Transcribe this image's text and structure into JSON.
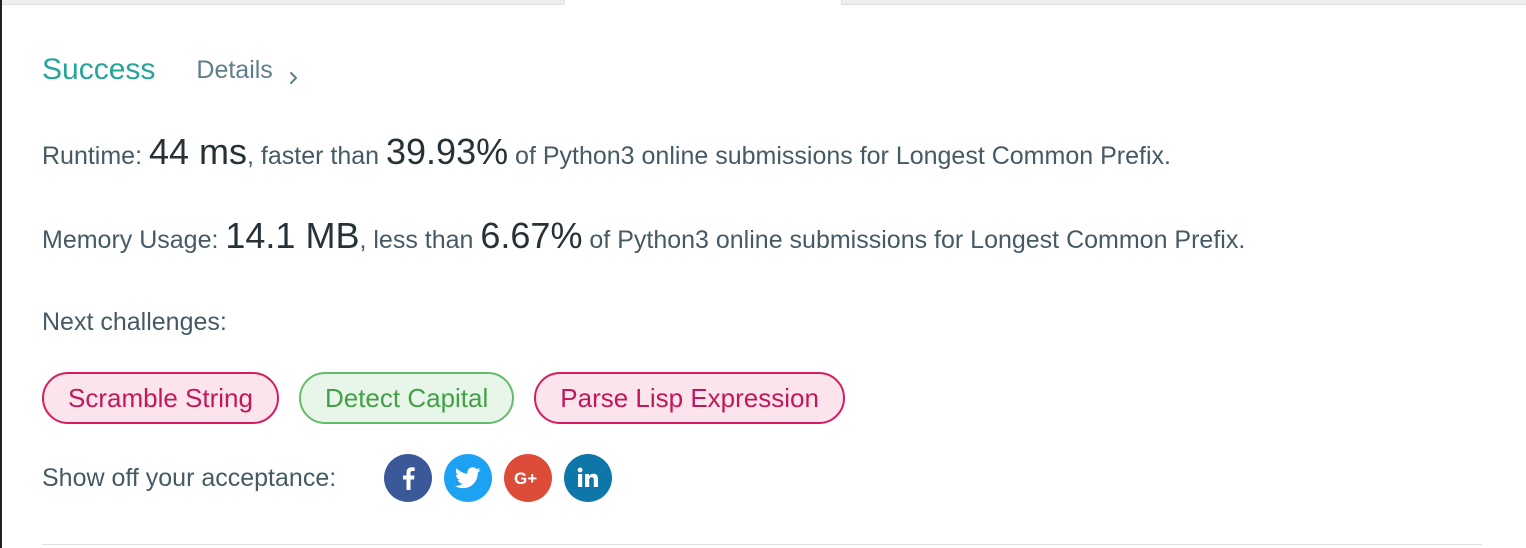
{
  "header": {
    "status": "Success",
    "details_label": "Details"
  },
  "runtime": {
    "label": "Runtime: ",
    "value": "44 ms",
    "comparison": ", faster than ",
    "percent": "39.93%",
    "suffix": " of Python3 online submissions for Longest Common Prefix."
  },
  "memory": {
    "label": "Memory Usage: ",
    "value": "14.1 MB",
    "comparison": ", less than ",
    "percent": "6.67%",
    "suffix": " of Python3 online submissions for Longest Common Prefix."
  },
  "next_challenges": {
    "label": "Next challenges:",
    "items": [
      {
        "label": "Scramble String",
        "difficulty": "hard"
      },
      {
        "label": "Detect Capital",
        "difficulty": "easy"
      },
      {
        "label": "Parse Lisp Expression",
        "difficulty": "hard"
      }
    ]
  },
  "share": {
    "label": "Show off your acceptance:",
    "buttons": [
      {
        "icon": "facebook-icon",
        "color": "#3b5998"
      },
      {
        "icon": "twitter-icon",
        "color": "#1da1f2"
      },
      {
        "icon": "google-plus-icon",
        "color": "#dd4b39"
      },
      {
        "icon": "linkedin-icon",
        "color": "#0e76a8"
      }
    ]
  },
  "colors": {
    "success": "#26a69a",
    "hard_text": "#c2185b",
    "easy_text": "#43a047"
  }
}
